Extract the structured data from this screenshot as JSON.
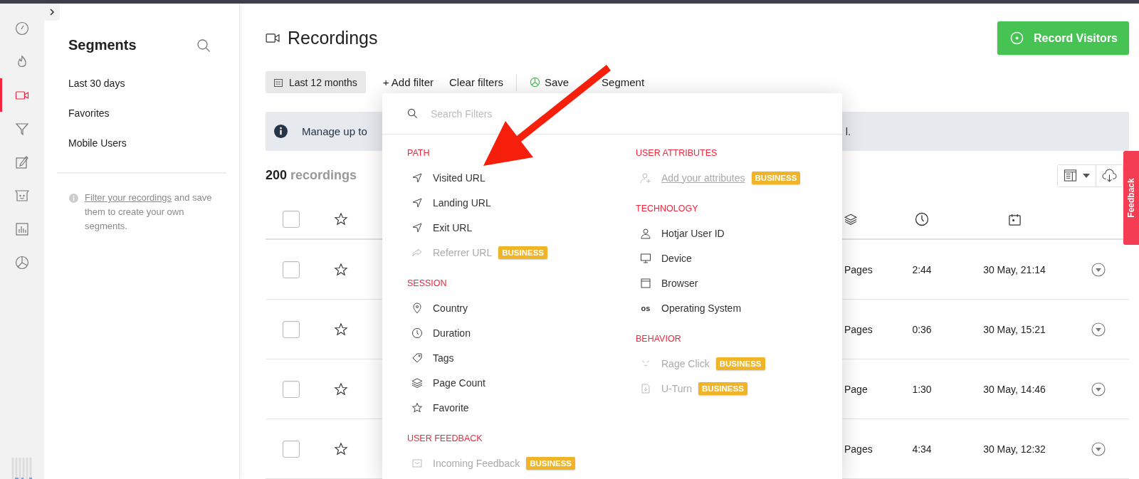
{
  "rail": {
    "items": [
      {
        "selected": false
      },
      {
        "selected": false
      },
      {
        "selected": true
      },
      {
        "selected": false
      },
      {
        "selected": false
      },
      {
        "selected": false
      },
      {
        "selected": false
      },
      {
        "selected": false
      }
    ]
  },
  "segments": {
    "title": "Segments",
    "items": [
      "Last 30 days",
      "Favorites",
      "Mobile Users"
    ],
    "help": {
      "link": "Filter your recordings",
      "text": "and save them to create your own segments."
    }
  },
  "page": {
    "title": "Recordings",
    "record_button": "Record Visitors"
  },
  "filters": {
    "date_range": "Last 12 months",
    "add_filter": "+ Add filter",
    "clear": "Clear filters",
    "save": "Save",
    "save_tail": "Segment"
  },
  "banner": {
    "text": "Manage up to",
    "tail": "l."
  },
  "count": "**200** recordings",
  "table": {
    "header_checked": false,
    "header_favorite": false,
    "rows": [
      {
        "checked": false,
        "favorite": false,
        "pages": "Pages",
        "duration": "2:44",
        "date": "30 May, 21:14"
      },
      {
        "checked": false,
        "favorite": false,
        "pages": "Pages",
        "duration": "0:36",
        "date": "30 May, 15:21"
      },
      {
        "checked": false,
        "favorite": false,
        "pages": "Page",
        "duration": "1:30",
        "date": "30 May, 14:46"
      },
      {
        "checked": false,
        "favorite": false,
        "pages": "Pages",
        "duration": "4:34",
        "date": "30 May, 12:32"
      }
    ]
  },
  "feedback_tab": "Feedback",
  "filter_menu": {
    "placeholder": "Search Filters",
    "columns": [
      [
        {
          "title": "PATH",
          "items": [
            {
              "label": "Visited URL",
              "disabled": false
            },
            {
              "label": "Landing URL",
              "disabled": false
            },
            {
              "label": "Exit URL",
              "disabled": false
            },
            {
              "label": "Referrer URL",
              "disabled": true,
              "badge": "BUSINESS"
            }
          ]
        },
        {
          "title": "SESSION",
          "items": [
            {
              "label": "Country",
              "disabled": false
            },
            {
              "label": "Duration",
              "disabled": false
            },
            {
              "label": "Tags",
              "disabled": false
            },
            {
              "label": "Page Count",
              "disabled": false
            },
            {
              "label": "Favorite",
              "disabled": false
            }
          ]
        },
        {
          "title": "USER FEEDBACK",
          "items": [
            {
              "label": "Incoming Feedback",
              "disabled": true,
              "badge": "BUSINESS"
            }
          ]
        }
      ],
      [
        {
          "title": "USER ATTRIBUTES",
          "items": [
            {
              "label": "Add your attributes",
              "disabled": true,
              "kind": "link",
              "badge": "BUSINESS"
            }
          ]
        },
        {
          "title": "TECHNOLOGY",
          "items": [
            {
              "label": "Hotjar User ID",
              "disabled": false
            },
            {
              "label": "Device",
              "disabled": false
            },
            {
              "label": "Browser",
              "disabled": false
            },
            {
              "label": "Operating System",
              "disabled": false,
              "icon_text": "os"
            }
          ]
        },
        {
          "title": "BEHAVIOR",
          "items": [
            {
              "label": "Rage Click",
              "disabled": true,
              "badge": "BUSINESS"
            },
            {
              "label": "U-Turn",
              "disabled": true,
              "badge": "BUSINESS"
            }
          ]
        }
      ]
    ]
  }
}
